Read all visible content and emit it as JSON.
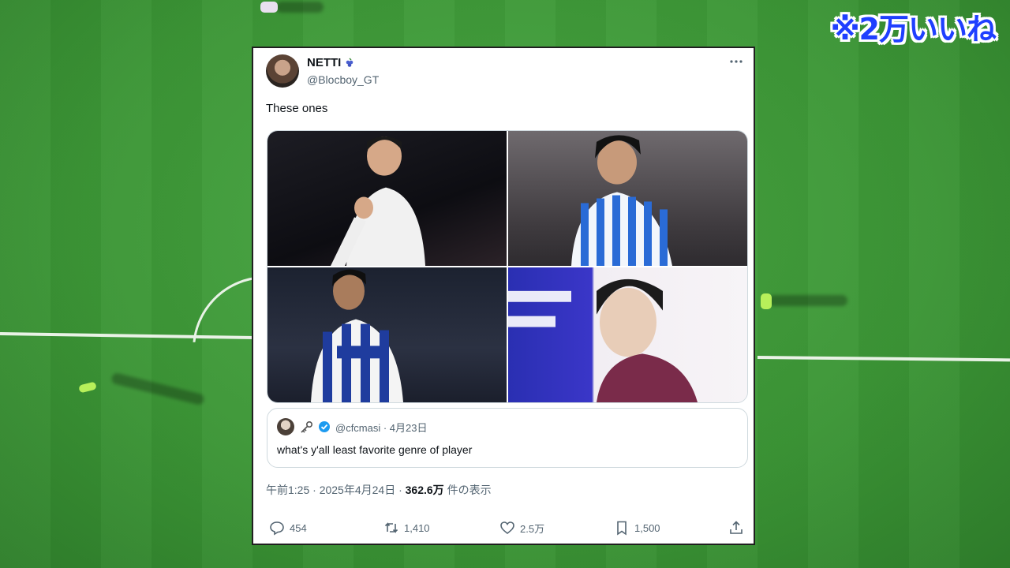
{
  "overlay": {
    "like_badge": "※2万いいね"
  },
  "tweet": {
    "author_name": "NETTI",
    "author_handle": "@Blocboy_GT",
    "text": "These ones",
    "photos": [
      "player-photo-1",
      "player-photo-2",
      "player-photo-3",
      "player-photo-4"
    ],
    "quote": {
      "handle_and_date": "@cfcmasi · 4月23日",
      "text": "what's y'all least favorite genre of player"
    },
    "meta": {
      "time_date": "午前1:25 · 2025年4月24日 · ",
      "views_count": "362.6万",
      "views_label": " 件の表示"
    },
    "actions": {
      "replies": "454",
      "retweets": "1,410",
      "likes": "2.5万",
      "bookmarks": "1,500"
    }
  },
  "colors": {
    "badge": "#1f3fff",
    "verified": "#1d9bf0"
  }
}
